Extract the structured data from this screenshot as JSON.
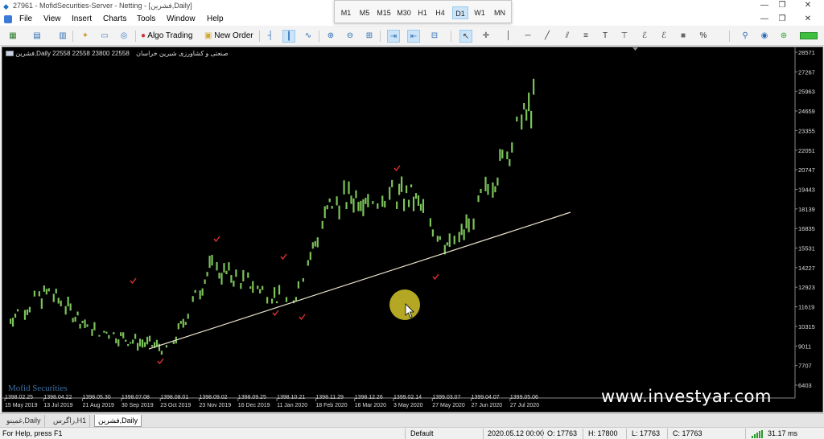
{
  "window": {
    "title": "27961 - MofidSecurities-Server - Netting - [فشرین,Daily]",
    "controls": [
      "—",
      "❐",
      "✕"
    ]
  },
  "timeframes": [
    {
      "label": "M1",
      "active": false
    },
    {
      "label": "M5",
      "active": false
    },
    {
      "label": "M15",
      "active": false
    },
    {
      "label": "M30",
      "active": false
    },
    {
      "label": "H1",
      "active": false
    },
    {
      "label": "H4",
      "active": false
    },
    {
      "label": "D1",
      "active": true
    },
    {
      "label": "W1",
      "active": false
    },
    {
      "label": "MN",
      "active": false
    }
  ],
  "menu": [
    "File",
    "View",
    "Insert",
    "Charts",
    "Tools",
    "Window",
    "Help"
  ],
  "toolbar": {
    "algo_trading": "Algo Trading",
    "new_order": "New Order",
    "icons": [
      "new-chart-icon",
      "profiles-icon",
      "market-watch-icon",
      "data-window-icon",
      "navigator-icon",
      "terminal-icon",
      "strategy-tester-icon",
      "algo-trading-icon",
      "new-order-icon",
      "bar-chart-icon",
      "candlestick-icon",
      "line-chart-icon",
      "zoom-in-icon",
      "zoom-out-icon",
      "tile-windows-icon",
      "auto-scroll-icon",
      "chart-shift-icon",
      "indicators-icon",
      "cursor-icon",
      "crosshair-icon",
      "vertical-line-icon",
      "horizontal-line-icon",
      "trendline-icon",
      "channel-icon",
      "fibonacci-icon",
      "text-icon",
      "text-label-icon",
      "elliott-icon",
      "shapes-icon",
      "arrows-icon",
      "search-icon",
      "vps-icon",
      "account-icon",
      "signal-strength-icon"
    ]
  },
  "chart": {
    "symbol_info": "فشرین,Daily  22558 22558 23800 22558",
    "description": "صنعتی و کشاورزی شیرین خراسان",
    "broker_watermark": "Mofid Securities",
    "site_watermark": "www.investyar.com",
    "cursor_highlight_color": "#d4c42a",
    "up_color": "#7cc35a",
    "down_color": "#7cc35a",
    "trendline_color": "#e8e0c8",
    "mark_color": "#e03030",
    "price_axis": [
      "28571",
      "27267",
      "25963",
      "24659",
      "23355",
      "22051",
      "20747",
      "19443",
      "18139",
      "16835",
      "15531",
      "14227",
      "12923",
      "11619",
      "10315",
      "9011",
      "7707",
      "6403"
    ],
    "date_axis_persian": [
      "1398.02.25",
      "1398.04.22",
      "1398.05.30",
      "1398.07.08",
      "1398.08.01",
      "1398.09.02",
      "1398.09.25",
      "1398.10.21",
      "1398.11.29",
      "1398.12.26",
      "1399.02.14",
      "1399.03.07",
      "1399.04.07",
      "1399.05.06"
    ],
    "date_axis_gregorian": [
      "15 May 2019",
      "13 Jul 2019",
      "21 Aug 2019",
      "30 Sep 2019",
      "23 Oct 2019",
      "23 Nov 2019",
      "16 Dec 2019",
      "11 Jan 2020",
      "18 Feb 2020",
      "16 Mar 2020",
      "3 May 2020",
      "27 May 2020",
      "27 Jun 2020",
      "27 Jul 2020"
    ]
  },
  "chart_data": {
    "type": "bar",
    "title": "فشرین,Daily",
    "ylim": [
      6403,
      28571
    ],
    "x": [
      "15 May 2019",
      "13 Jul 2019",
      "21 Aug 2019",
      "30 Sep 2019",
      "23 Oct 2019",
      "23 Nov 2019",
      "16 Dec 2019",
      "11 Jan 2020",
      "18 Feb 2020",
      "16 Mar 2020",
      "3 May 2020",
      "27 May 2020",
      "27 Jun 2020",
      "27 Jul 2020"
    ],
    "series": [
      {
        "values": [
          10800,
          12600,
          10300,
          9400,
          8800,
          14200,
          13200,
          11800,
          18600,
          19200,
          18900,
          15300,
          20100,
          25300
        ]
      }
    ]
  },
  "tabs": [
    {
      "label": "غمینو,Daily",
      "active": false
    },
    {
      "label": "راگرس,H1",
      "active": false
    },
    {
      "label": "فشرین,Daily",
      "active": true
    }
  ],
  "status": {
    "help": "For Help, press F1",
    "profile": "Default",
    "datetime": "2020.05.12 00:00",
    "open": "O: 17763",
    "high": "H: 17800",
    "low": "L: 17763",
    "close": "C: 17763",
    "ping": "31.17 ms"
  }
}
